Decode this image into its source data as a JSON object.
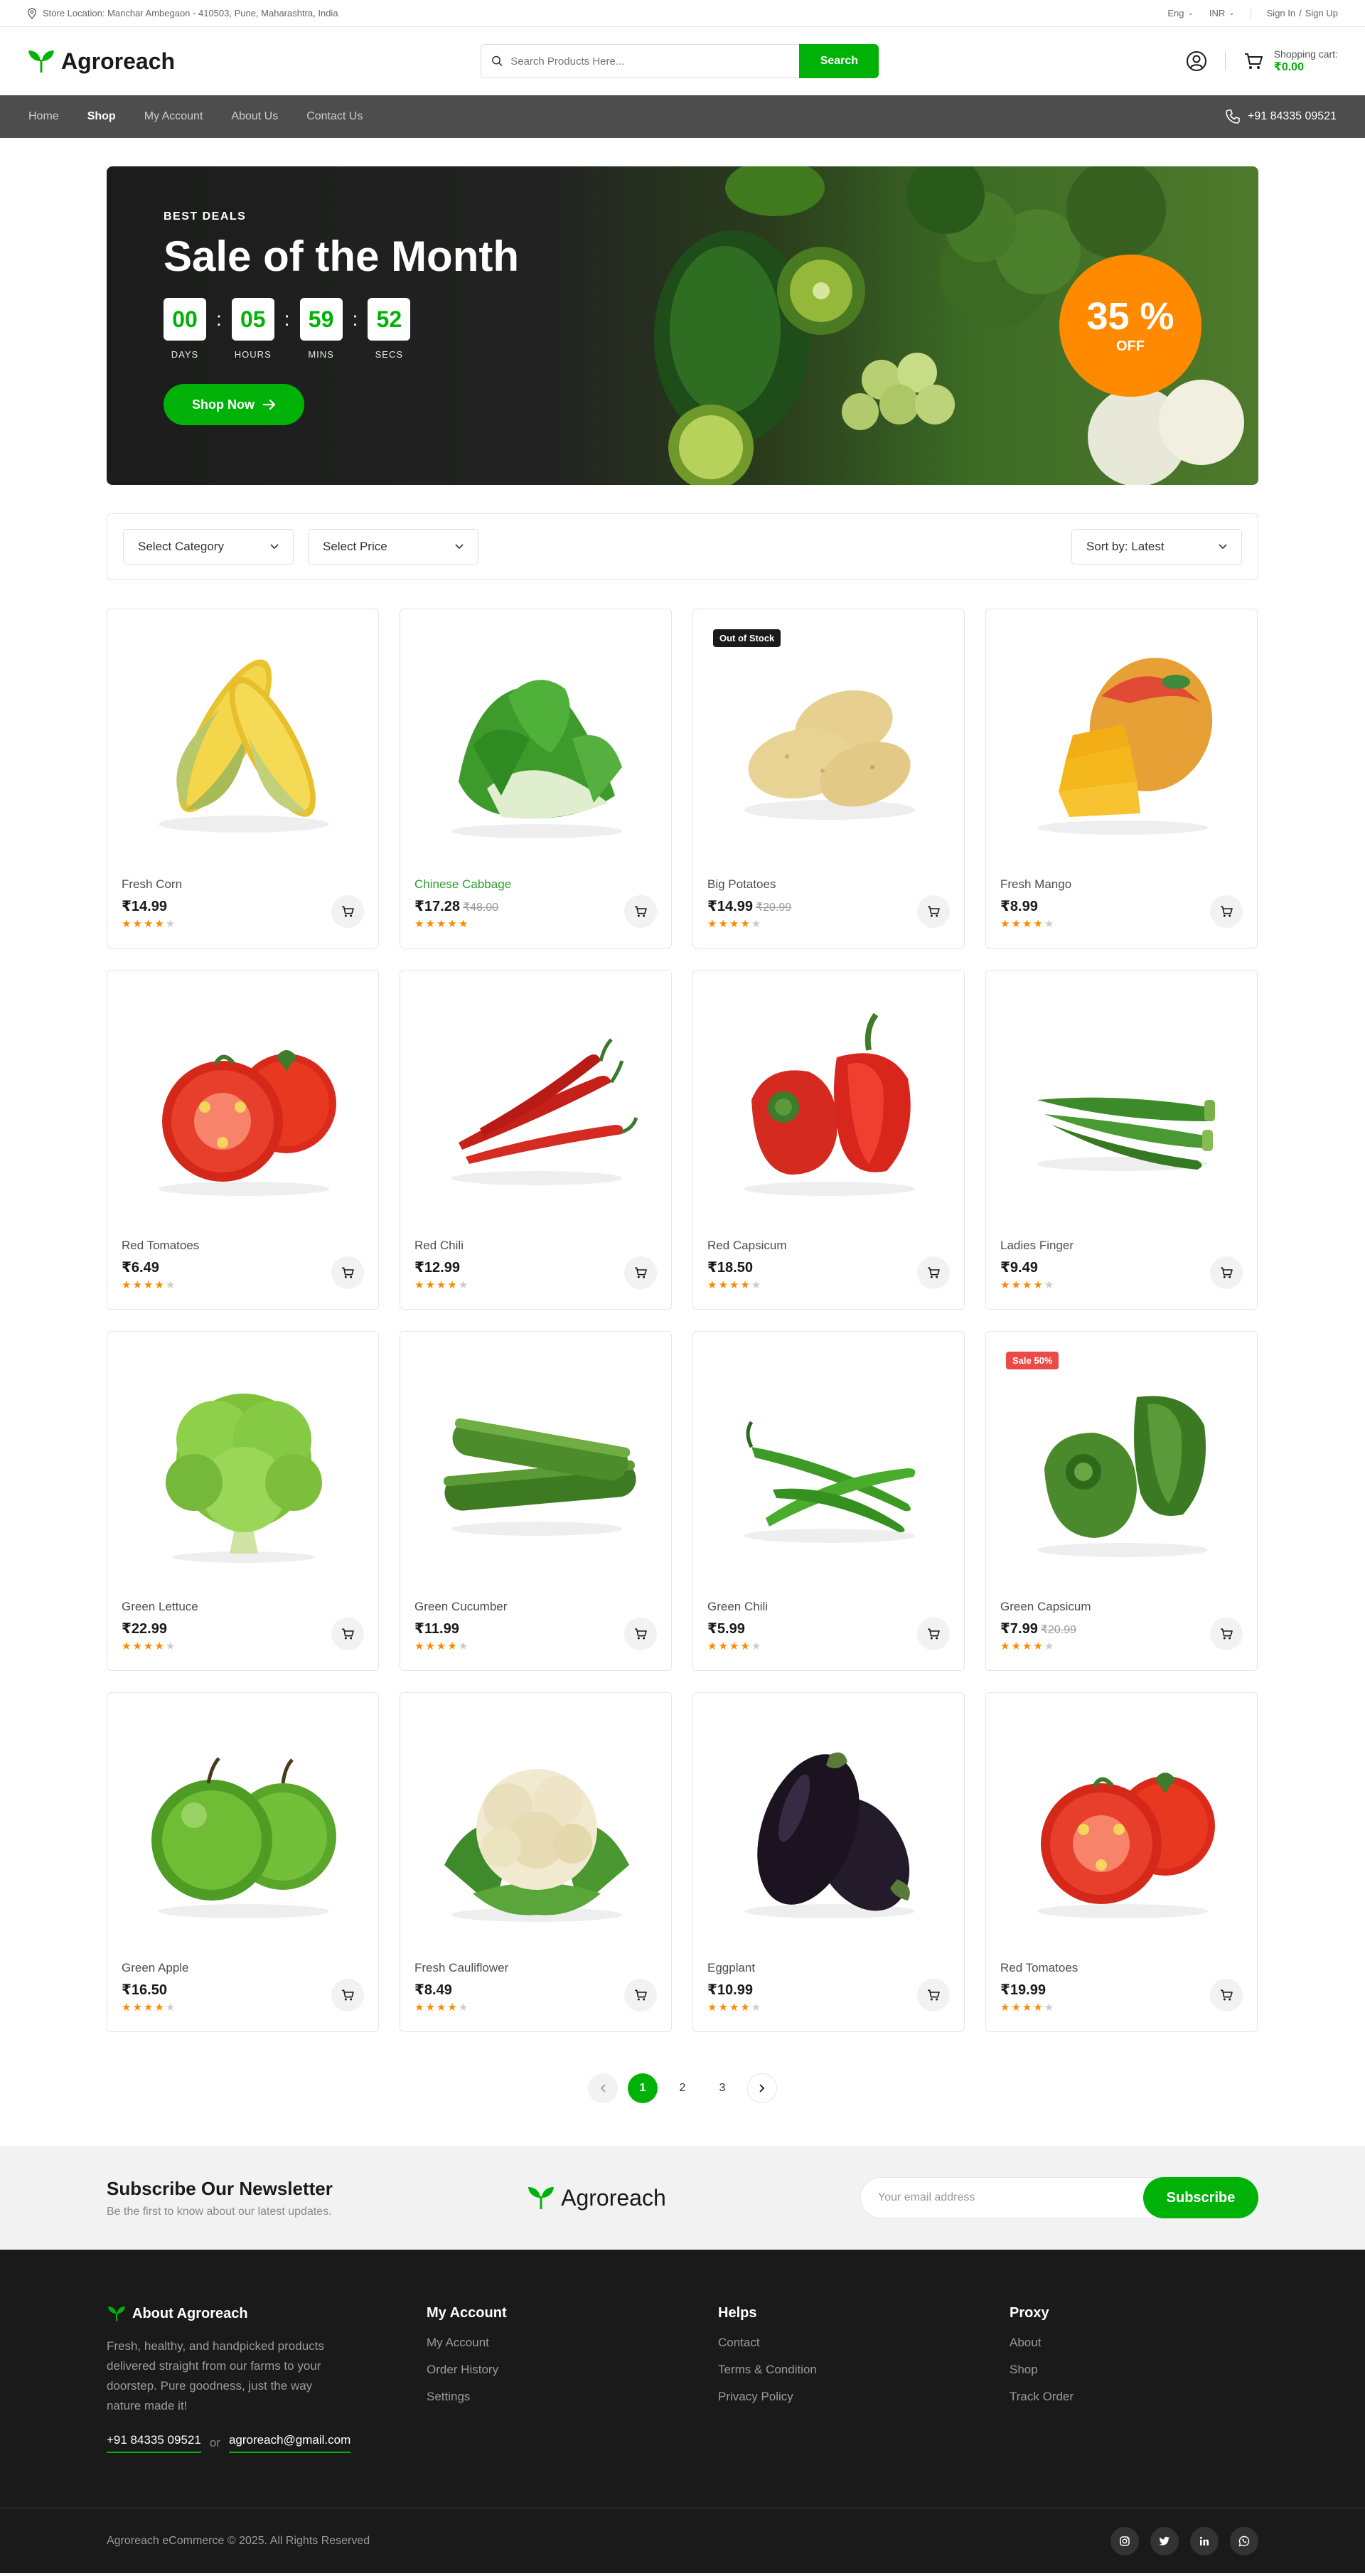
{
  "topbar": {
    "store_location": "Store Location: Manchar Ambegaon - 410503, Pune, Maharashtra, India",
    "language": "Eng",
    "currency": "INR",
    "sign_in": "Sign In",
    "slash": "/",
    "sign_up": "Sign Up"
  },
  "header": {
    "brand": "Agroreach",
    "search_placeholder": "Search Products Here...",
    "search_button": "Search",
    "cart_label": "Shopping cart:",
    "cart_total": "₹0.00"
  },
  "nav": {
    "items": [
      "Home",
      "Shop",
      "My Account",
      "About Us",
      "Contact Us"
    ],
    "active": "Shop",
    "phone": "+91 84335 09521"
  },
  "banner": {
    "eyebrow": "BEST DEALS",
    "title": "Sale of the Month",
    "countdown": [
      {
        "value": "00",
        "label": "DAYS"
      },
      {
        "value": "05",
        "label": "HOURS"
      },
      {
        "value": "59",
        "label": "MINS"
      },
      {
        "value": "52",
        "label": "SECS"
      }
    ],
    "colon": ":",
    "cta": "Shop Now",
    "discount_pct": "35 %",
    "discount_off": "OFF"
  },
  "filters": {
    "category": "Select Category",
    "price": "Select Price",
    "sort": "Sort by: Latest"
  },
  "products": [
    {
      "name": "Fresh Corn",
      "price": "₹14.99",
      "old_price": "",
      "rating": 4,
      "badge": "",
      "illus": "corn"
    },
    {
      "name": "Chinese Cabbage",
      "price": "₹17.28",
      "old_price": "₹48.00",
      "rating": 5,
      "badge": "",
      "illus": "cabbage",
      "highlight": true
    },
    {
      "name": "Big Potatoes",
      "price": "₹14.99",
      "old_price": "₹20.99",
      "rating": 4,
      "badge": "Out of Stock",
      "badge_style": "dark",
      "illus": "potato"
    },
    {
      "name": "Fresh Mango",
      "price": "₹8.99",
      "old_price": "",
      "rating": 4,
      "badge": "",
      "illus": "mango"
    },
    {
      "name": "Red Tomatoes",
      "price": "₹6.49",
      "old_price": "",
      "rating": 4,
      "badge": "",
      "illus": "tomato"
    },
    {
      "name": "Red Chili",
      "price": "₹12.99",
      "old_price": "",
      "rating": 4,
      "badge": "",
      "illus": "redchili"
    },
    {
      "name": "Red Capsicum",
      "price": "₹18.50",
      "old_price": "",
      "rating": 4,
      "badge": "",
      "illus": "redcapsicum"
    },
    {
      "name": "Ladies Finger",
      "price": "₹9.49",
      "old_price": "",
      "rating": 4,
      "badge": "",
      "illus": "okra"
    },
    {
      "name": "Green Lettuce",
      "price": "₹22.99",
      "old_price": "",
      "rating": 4,
      "badge": "",
      "illus": "lettuce"
    },
    {
      "name": "Green Cucumber",
      "price": "₹11.99",
      "old_price": "",
      "rating": 4,
      "badge": "",
      "illus": "cucumber"
    },
    {
      "name": "Green Chili",
      "price": "₹5.99",
      "old_price": "",
      "rating": 4,
      "badge": "",
      "illus": "greenchili"
    },
    {
      "name": "Green Capsicum",
      "price": "₹7.99",
      "old_price": "₹20.99",
      "rating": 4,
      "badge": "Sale 50%",
      "badge_style": "red",
      "illus": "greencapsicum"
    },
    {
      "name": "Green Apple",
      "price": "₹16.50",
      "old_price": "",
      "rating": 4,
      "badge": "",
      "illus": "apple"
    },
    {
      "name": "Fresh Cauliflower",
      "price": "₹8.49",
      "old_price": "",
      "rating": 4,
      "badge": "",
      "illus": "cauliflower"
    },
    {
      "name": "Eggplant",
      "price": "₹10.99",
      "old_price": "",
      "rating": 4,
      "badge": "",
      "illus": "eggplant"
    },
    {
      "name": "Red Tomatoes",
      "price": "₹19.99",
      "old_price": "",
      "rating": 4,
      "badge": "",
      "illus": "tomato"
    }
  ],
  "pagination": {
    "pages": [
      "1",
      "2",
      "3"
    ],
    "current": "1"
  },
  "newsletter": {
    "title": "Subscribe Our Newsletter",
    "subtitle": "Be the first to know about our latest updates.",
    "brand": "Agroreach",
    "placeholder": "Your email address",
    "button": "Subscribe"
  },
  "footer": {
    "about_title": "About Agroreach",
    "about_text": "Fresh, healthy, and handpicked products delivered straight from our farms to your doorstep. Pure goodness, just the way nature made it!",
    "phone": "+91 84335 09521",
    "or": "or",
    "email": "agroreach@gmail.com",
    "columns": [
      {
        "title": "My Account",
        "links": [
          "My Account",
          "Order History",
          "Settings"
        ]
      },
      {
        "title": "Helps",
        "links": [
          "Contact",
          "Terms & Condition",
          "Privacy Policy"
        ]
      },
      {
        "title": "Proxy",
        "links": [
          "About",
          "Shop",
          "Track Order"
        ]
      }
    ],
    "copyright": "Agroreach eCommerce © 2025. All Rights Reserved",
    "socials": [
      "instagram-icon",
      "twitter-icon",
      "linkedin-icon",
      "whatsapp-icon"
    ]
  },
  "colors": {
    "brand_green": "#00b207",
    "discount_orange": "#ff8a00",
    "nav_gray": "#4d4d4d",
    "footer_dark": "#1a1a1a",
    "sale_red": "#ea4b48"
  }
}
